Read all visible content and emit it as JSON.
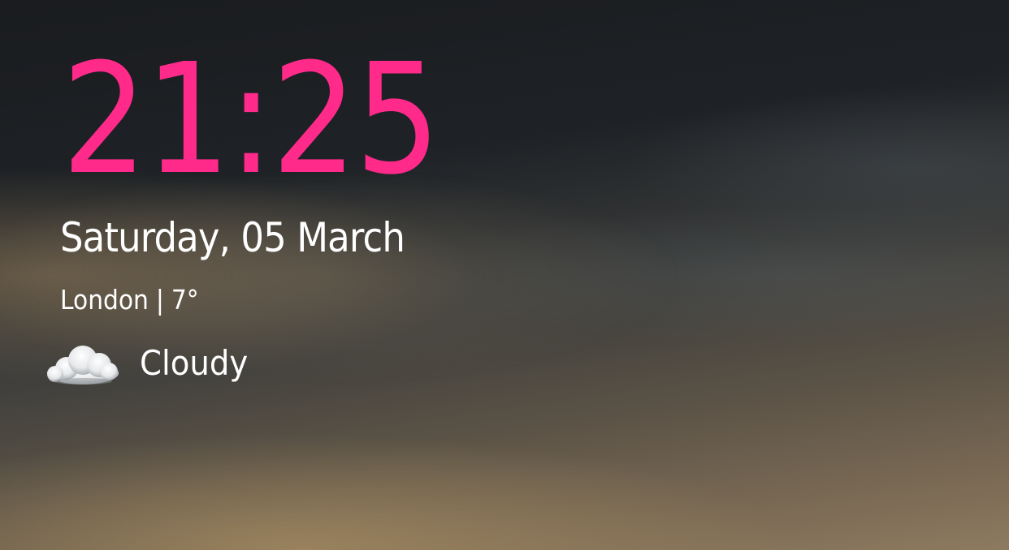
{
  "clock": {
    "time": "21:25",
    "date": "Saturday, 05 March",
    "accent_color": "#ff2a8a"
  },
  "weather": {
    "location": "London",
    "separator": "|",
    "temperature": "7°",
    "condition": "Cloudy",
    "icon": "cloud-icon"
  }
}
